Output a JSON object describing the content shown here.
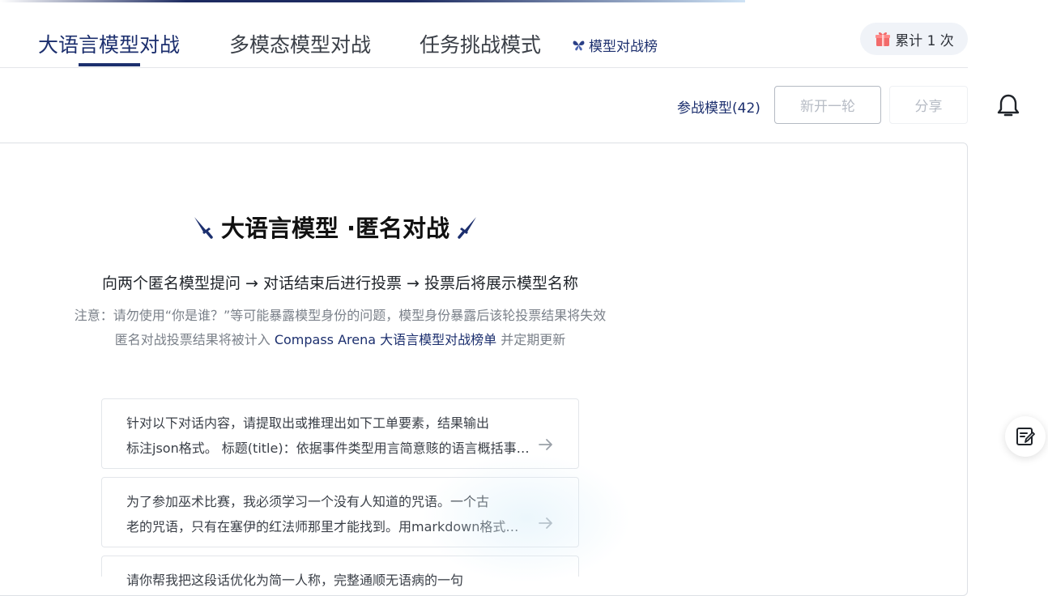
{
  "tabs": [
    {
      "label": "大语言模型对战",
      "active": true
    },
    {
      "label": "多模态模型对战",
      "active": false
    },
    {
      "label": "任务挑战模式",
      "active": false
    }
  ],
  "leaderboard": {
    "label": "模型对战榜",
    "icon": "butterfly-icon"
  },
  "counter": {
    "label": "累计 1 次",
    "icon": "gift-icon"
  },
  "toolbar": {
    "models_label": "参战模型(42)",
    "new_round_label": "新开一轮",
    "share_label": "分享"
  },
  "hero": {
    "title": "大语言模型 ·匿名对战",
    "subtitle": "向两个匿名模型提问 → 对话结束后进行投票 → 投票后将展示模型名称",
    "notice": "注意：请勿使用“你是谁？”等可能暴露模型身份的问题，模型身份暴露后该轮投票结果将失效",
    "notice2_prefix": "匿名对战投票结果将被计入 ",
    "notice2_link": "Compass Arena 大语言模型对战榜单",
    "notice2_suffix": " 并定期更新"
  },
  "prompts": [
    {
      "line1": "针对以下对话内容，请提取出或推理出如下工单要素，结果输出",
      "line2": "标注json格式。 标题(title)：依据事件类型用言简意赅的语言概括事件内容"
    },
    {
      "line1": "为了参加巫术比赛，我必须学习一个没有人知道的咒语。一个古",
      "line2": "老的咒语，只有在塞伊的红法师那里才能找到。用markdown格式写出咒语"
    },
    {
      "line1": "请你帮我把这段话优化为简一人称，完整通顺无语病的一句",
      "line2": ""
    }
  ],
  "colors": {
    "accent": "#1c2f6e",
    "muted": "#b7bcc5"
  }
}
